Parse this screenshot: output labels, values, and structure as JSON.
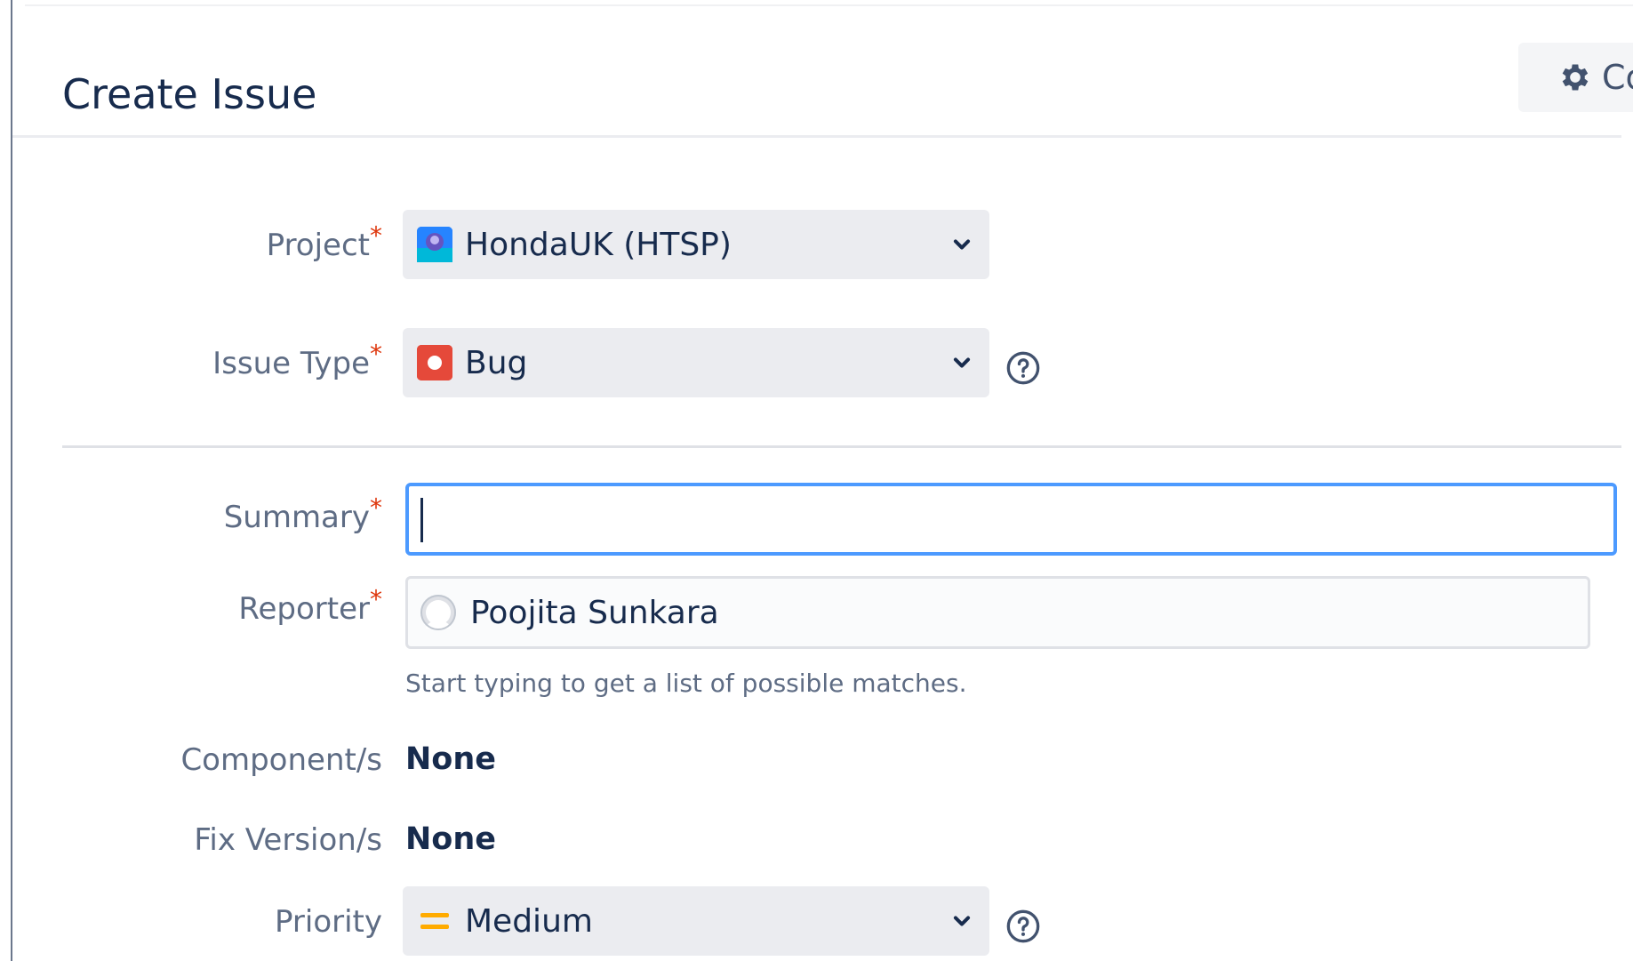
{
  "header": {
    "title": "Create Issue",
    "configure_label": "Co"
  },
  "fields": {
    "project": {
      "label": "Project",
      "value": "HondaUK (HTSP)",
      "icon": "project-avatar-icon"
    },
    "issue_type": {
      "label": "Issue Type",
      "value": "Bug",
      "icon": "bug-icon"
    },
    "summary": {
      "label": "Summary",
      "value": ""
    },
    "reporter": {
      "label": "Reporter",
      "value": "Poojita Sunkara",
      "helper": "Start typing to get a list of possible matches."
    },
    "components": {
      "label": "Component/s",
      "value": "None"
    },
    "fix_versions": {
      "label": "Fix Version/s",
      "value": "None"
    },
    "priority": {
      "label": "Priority",
      "value": "Medium",
      "icon": "priority-medium-icon"
    }
  },
  "required_marker": "*",
  "colors": {
    "required": "#de350b",
    "focus_border": "#4c9aff",
    "bug": "#e5493a",
    "priority_medium": "#ffab00",
    "project_icon": "#1d7af3"
  }
}
